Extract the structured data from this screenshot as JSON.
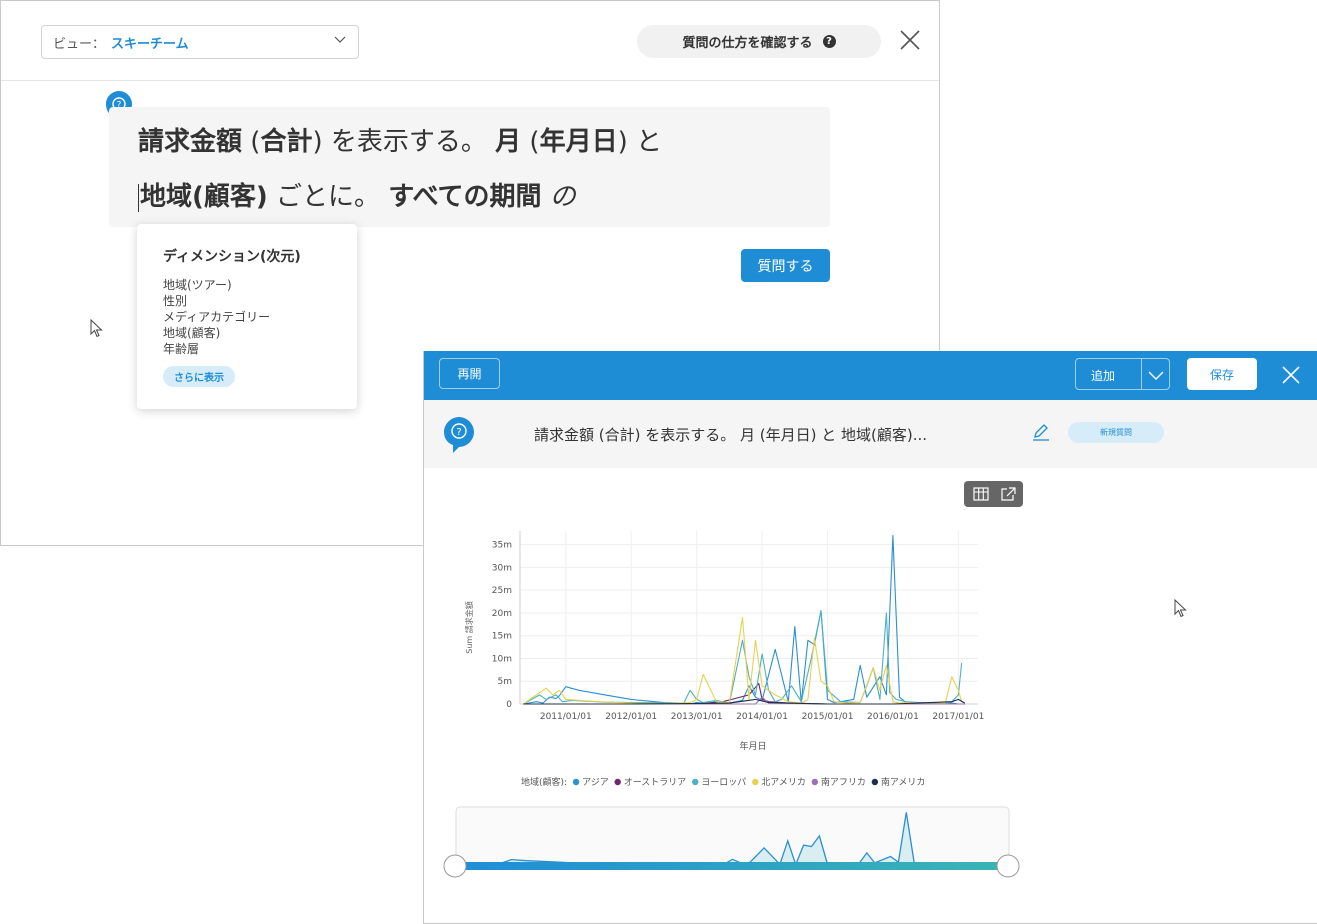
{
  "background_dialog": {
    "view_label": "ビュー：",
    "view_value": "スキーチーム",
    "help_button": "質問の仕方を確認する",
    "query_line1": [
      {
        "text": "請求金額",
        "bold": true
      },
      {
        "text": " (",
        "bold": false
      },
      {
        "text": "合計",
        "bold": true
      },
      {
        "text": ") を表示する。 ",
        "bold": false
      },
      {
        "text": "月",
        "bold": true
      },
      {
        "text": " (",
        "bold": false
      },
      {
        "text": "年月日",
        "bold": true
      },
      {
        "text": ") と",
        "bold": false
      }
    ],
    "query_line2": [
      {
        "text": "地域(顧客)",
        "bold": true
      },
      {
        "text": " ごとに。 ",
        "bold": false
      },
      {
        "text": "すべての期間",
        "bold": true
      },
      {
        "text": " の",
        "bold": false,
        "italic": true
      }
    ],
    "ask_button": "質問する",
    "dimension_popup": {
      "title": "ディメンション(次元)",
      "items": [
        "地域(ツアー)",
        "性別",
        "メディアカテゴリー",
        "地域(顧客)",
        "年齢層"
      ],
      "more_button": "さらに表示"
    }
  },
  "result_panel": {
    "reopen_button": "再開",
    "add_button": "追加",
    "save_button": "保存",
    "query_text": "請求金額 (合計) を表示する。 月 (年月日) と 地域(顧客)...",
    "new_question_badge": "新規質問",
    "accent_color": "#1f8dd6"
  },
  "chart_data": {
    "type": "line",
    "title": "",
    "xlabel": "年月日",
    "ylabel": "Sum 請求金額",
    "ylim": [
      0,
      38
    ],
    "y_ticks": [
      0,
      5,
      10,
      15,
      20,
      25,
      30,
      35
    ],
    "y_tick_labels": [
      "0",
      "5m",
      "10m",
      "15m",
      "20m",
      "25m",
      "30m",
      "35m"
    ],
    "x_tick_labels": [
      "2011/01/01",
      "2012/01/01",
      "2013/01/01",
      "2014/01/01",
      "2015/01/01",
      "2016/01/01",
      "2017/01/01"
    ],
    "x_range": [
      2010.3,
      2017.3
    ],
    "grid": true,
    "legend_title": "地域(顧客):",
    "legend_position": "bottom",
    "series": [
      {
        "name": "アジア",
        "color": "#2b8fd0",
        "x": [
          2010.35,
          2010.55,
          2010.65,
          2010.75,
          2010.85,
          2010.9,
          2011.0,
          2011.2,
          2011.6,
          2012.0,
          2012.5,
          2012.8,
          2012.9,
          2013.0,
          2013.15,
          2013.3,
          2013.5,
          2013.7,
          2013.8,
          2013.9,
          2014.0,
          2014.2,
          2014.4,
          2014.5,
          2014.6,
          2014.7,
          2014.8,
          2014.9,
          2015.0,
          2015.1,
          2015.2,
          2015.4,
          2015.5,
          2015.6,
          2015.8,
          2015.9,
          2016.0,
          2016.1,
          2016.2,
          2016.3,
          2016.5,
          2016.6,
          2016.8,
          2016.9,
          2017.0,
          2017.1
        ],
        "y": [
          0,
          0.5,
          0.2,
          1.5,
          1.2,
          1.8,
          3.8,
          3.0,
          2.0,
          1.0,
          0.3,
          0.2,
          0,
          0.3,
          0.1,
          0.5,
          0.2,
          0.8,
          4,
          1.5,
          0.8,
          12,
          0.5,
          17,
          0.3,
          14,
          13,
          20.5,
          1.0,
          0.3,
          0.5,
          1.0,
          8.5,
          1.5,
          6.0,
          2.0,
          37,
          1.5,
          0.3,
          0.2,
          0.1,
          0.2,
          0.3,
          0.2,
          0,
          0
        ]
      },
      {
        "name": "オーストラリア",
        "color": "#6b2a6b",
        "x": [
          2010.35,
          2011.0,
          2012.0,
          2013.0,
          2013.4,
          2013.8,
          2013.95,
          2014.0,
          2014.1,
          2014.4,
          2015.0,
          2016.0,
          2017.0,
          2017.1
        ],
        "y": [
          0,
          0,
          0,
          0,
          0.5,
          2.0,
          4.5,
          1.0,
          0.5,
          0.2,
          0,
          0,
          0,
          0
        ]
      },
      {
        "name": "ヨーロッパ",
        "color": "#4db0c4",
        "x": [
          2010.35,
          2010.6,
          2010.7,
          2010.85,
          2010.95,
          2011.1,
          2011.6,
          2012.2,
          2012.6,
          2012.8,
          2012.9,
          2013.0,
          2013.1,
          2013.3,
          2013.5,
          2013.7,
          2013.8,
          2013.9,
          2014.0,
          2014.1,
          2014.2,
          2014.3,
          2014.45,
          2014.6,
          2014.75,
          2014.9,
          2015.0,
          2015.2,
          2015.5,
          2015.6,
          2015.7,
          2015.8,
          2015.9,
          2015.95,
          2016.05,
          2016.2,
          2016.4,
          2016.6,
          2016.8,
          2016.9,
          2017.0,
          2017.05
        ],
        "y": [
          0,
          2.0,
          1.0,
          2.0,
          0.5,
          0.8,
          0.4,
          0.3,
          0.2,
          0.1,
          3.0,
          1.0,
          0.3,
          0.8,
          0.2,
          14,
          6,
          2,
          11,
          3,
          0.5,
          1,
          4,
          0.5,
          10,
          20.5,
          3,
          0.5,
          0.3,
          4,
          8.0,
          1.0,
          20,
          2.5,
          1.0,
          0.5,
          0.3,
          0.3,
          0.2,
          0.5,
          2.0,
          9
        ]
      },
      {
        "name": "北アメリカ",
        "color": "#e8d150",
        "x": [
          2010.35,
          2010.7,
          2010.8,
          2010.9,
          2011.0,
          2011.5,
          2012.0,
          2012.5,
          2012.9,
          2013.0,
          2013.1,
          2013.3,
          2013.5,
          2013.7,
          2013.8,
          2013.9,
          2014.0,
          2014.2,
          2014.4,
          2014.6,
          2014.7,
          2014.8,
          2014.9,
          2015.0,
          2015.1,
          2015.3,
          2015.5,
          2015.7,
          2015.8,
          2015.9,
          2016.0,
          2016.1,
          2016.2,
          2016.4,
          2016.6,
          2016.8,
          2016.9,
          2017.0,
          2017.05
        ],
        "y": [
          0,
          3.5,
          2.0,
          3.0,
          1.0,
          0.5,
          0.2,
          0.1,
          0.3,
          1.0,
          6.5,
          0.5,
          0.3,
          19,
          1.0,
          14,
          4,
          2,
          0.5,
          0.2,
          1.0,
          14.5,
          5,
          4,
          0.5,
          0.2,
          0.3,
          8.0,
          3.0,
          8.5,
          0.5,
          0.2,
          0.3,
          0.2,
          0.3,
          0.2,
          6.0,
          3.0,
          0.5
        ]
      },
      {
        "name": "南アフリカ",
        "color": "#9b6fb3",
        "x": [
          2010.35,
          2012.0,
          2013.9,
          2014.0,
          2014.1,
          2015.0,
          2017.1
        ],
        "y": [
          0,
          0,
          0,
          1.5,
          0.2,
          0,
          0
        ]
      },
      {
        "name": "南アメリカ",
        "color": "#1c2f4a",
        "x": [
          2010.35,
          2011.0,
          2012.0,
          2013.0,
          2013.5,
          2013.9,
          2014.1,
          2015.0,
          2016.0,
          2016.9,
          2017.0,
          2017.1
        ],
        "y": [
          0,
          0,
          0,
          0.1,
          0.2,
          1.0,
          0.3,
          0,
          0,
          0.5,
          1.0,
          0.2
        ]
      }
    ]
  }
}
